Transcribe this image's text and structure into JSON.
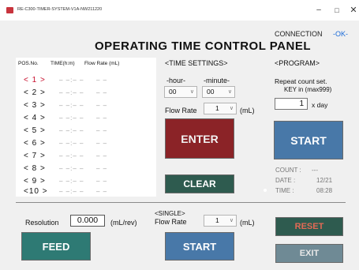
{
  "window": {
    "title": "RE-C300-TIMER-SYSTEM-V1A-NW211220",
    "minimize": "–",
    "maximize": "□",
    "close": "✕"
  },
  "connection": {
    "label": "CONNECTION",
    "status": "-OK-"
  },
  "main_title": "OPERATING TIME  CONTROL PANEL",
  "table": {
    "headers": {
      "pos": "POS.No.",
      "time": "TIME(h:m)",
      "rate": "Flow Rate (mL)"
    },
    "rows": [
      {
        "pos": "< 1 >",
        "time": "– –:– –",
        "rate": "– –",
        "selected": true
      },
      {
        "pos": "< 2 >",
        "time": "– –:– –",
        "rate": "– –"
      },
      {
        "pos": "< 3 >",
        "time": "– –:– –",
        "rate": "– –"
      },
      {
        "pos": "< 4 >",
        "time": "– –:– –",
        "rate": "– –"
      },
      {
        "pos": "< 5 >",
        "time": "– –:– –",
        "rate": "– –"
      },
      {
        "pos": "< 6 >",
        "time": "– –:– –",
        "rate": "– –"
      },
      {
        "pos": "< 7 >",
        "time": "– –:– –",
        "rate": "– –"
      },
      {
        "pos": "< 8 >",
        "time": "– –:– –",
        "rate": "– –"
      },
      {
        "pos": "< 9 >",
        "time": "– –:– –",
        "rate": "– –"
      },
      {
        "pos": "<10 >",
        "time": "– –:– –",
        "rate": "– –"
      }
    ]
  },
  "time_settings": {
    "header": "<TIME SETTINGS>",
    "hour_label": "-hour-",
    "minute_label": "-minute-",
    "hour_value": "00",
    "minute_value": "00",
    "flow_label": "Flow Rate",
    "flow_value": "1",
    "flow_unit": "(mL)",
    "enter_label": "ENTER",
    "clear_label": "CLEAR"
  },
  "program": {
    "header": "<PROGRAM>",
    "repeat_label": "Repeat count set.",
    "key_label": "KEY in (max999)",
    "count_value": "1",
    "xday_label": "x day",
    "start_label": "START",
    "count_label": "COUNT :",
    "count_display": "---",
    "date_label": "DATE :",
    "date_value": "12/21",
    "time_label": "TIME :",
    "time_value": "08:28"
  },
  "feed": {
    "resolution_label": "Resolution",
    "resolution_value": "0.000",
    "resolution_unit": "(mL/rev)",
    "feed_label": "FEED"
  },
  "single": {
    "header": "<SINGLE>",
    "flow_label": "Flow Rate",
    "flow_value": "1",
    "flow_unit": "(mL)",
    "start_label": "START"
  },
  "controls": {
    "reset_label": "RESET",
    "exit_label": "EXIT"
  },
  "colors": {
    "enter": "#8b2327",
    "start": "#4878a8",
    "clear": "#2e5b4f",
    "feed": "#2e7a74",
    "reset_text": "#e36a55",
    "exit": "#6f8a95",
    "selected_row": "#c8102e",
    "connection_ok": "#1a6bd8"
  }
}
